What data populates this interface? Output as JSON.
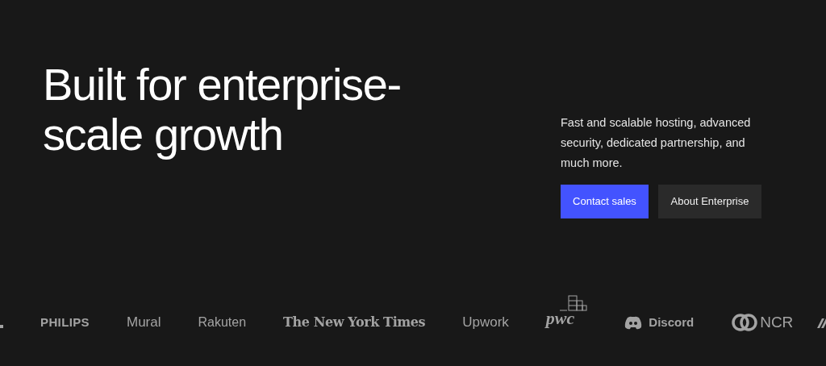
{
  "hero": {
    "heading": "Built for enterprise-scale growth",
    "description": "Fast and scalable hosting, advanced security, dedicated partnership, and much more.",
    "buttons": [
      {
        "label": "Contact sales",
        "kind": "primary"
      },
      {
        "label": "About Enterprise",
        "kind": "secondary"
      }
    ]
  },
  "logos": [
    {
      "text": "PHILIPS",
      "kind": "philips"
    },
    {
      "text": "Mural",
      "kind": "mural"
    },
    {
      "text": "Rakuten",
      "kind": "rakuten"
    },
    {
      "text": "The New York Times",
      "kind": "nyt"
    },
    {
      "text": "Upwork",
      "kind": "upwork"
    },
    {
      "text": "pwc",
      "kind": "pwc"
    },
    {
      "text": "Discord",
      "kind": "discord"
    },
    {
      "text": "NCR",
      "kind": "ncr"
    }
  ]
}
